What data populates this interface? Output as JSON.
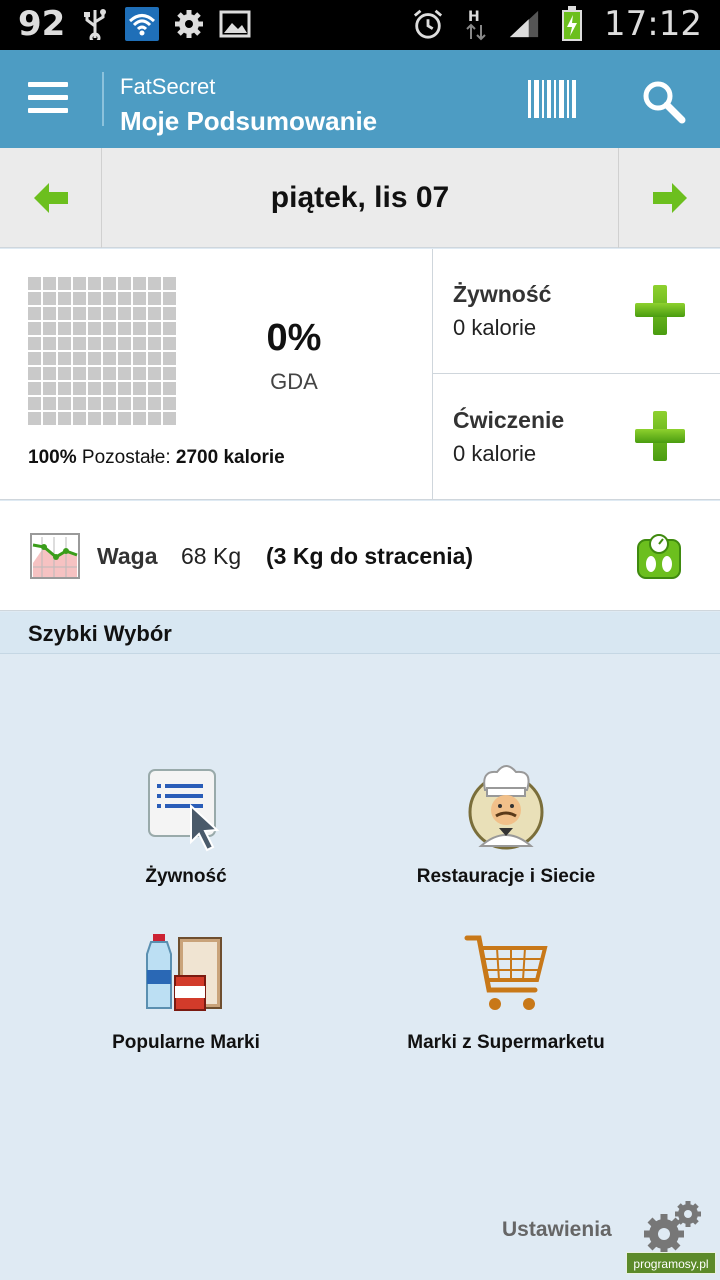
{
  "status_bar": {
    "notification_count": "92",
    "time": "17:12"
  },
  "app_bar": {
    "app_name": "FatSecret",
    "title": "Moje Podsumowanie"
  },
  "date_nav": {
    "date": "piątek, lis 07"
  },
  "summary": {
    "gda_percent": "0%",
    "gda_label": "GDA",
    "remaining_percent": "100%",
    "remaining_label": "Pozostałe:",
    "remaining_value": "2700 kalorie",
    "food_title": "Żywność",
    "food_value": "0 kalorie",
    "exercise_title": "Ćwiczenie",
    "exercise_value": "0 kalorie"
  },
  "weight": {
    "label": "Waga",
    "value": "68 Kg",
    "goal": "(3 Kg do stracenia)"
  },
  "quick": {
    "title": "Szybki Wybór",
    "items": [
      {
        "label": "Żywność",
        "icon": "food-list-icon"
      },
      {
        "label": "Restauracje i Siecie",
        "icon": "chef-icon"
      },
      {
        "label": "Popularne Marki",
        "icon": "brands-icon"
      },
      {
        "label": "Marki z Supermarketu",
        "icon": "shopping-cart-icon"
      }
    ]
  },
  "settings_label": "Ustawienia",
  "watermark": "programosy.pl",
  "colors": {
    "app_bar": "#4d9cc3",
    "accent_green": "#6cbf1e",
    "background": "#dfeaf3"
  }
}
